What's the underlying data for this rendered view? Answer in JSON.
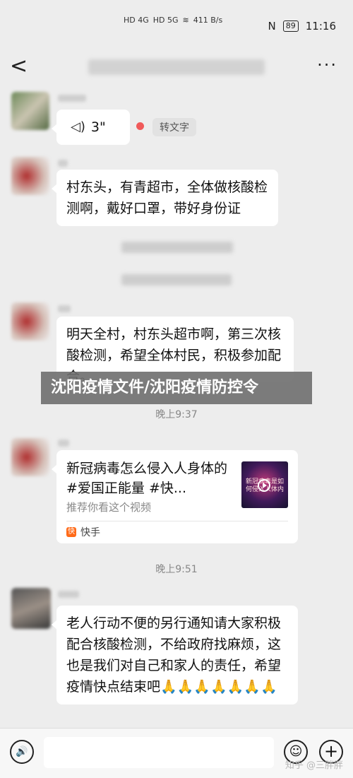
{
  "status_bar": {
    "net1": "HD 4G",
    "net2": "HD 5G",
    "speed": "411 B/s",
    "battery": "89",
    "time": "11:16"
  },
  "nav": {
    "back": "<",
    "more": "···"
  },
  "messages": {
    "voice": {
      "duration": "3\"",
      "to_text": "转文字"
    },
    "msg1": "村东头，有青超市，全体做核酸检测啊，戴好口罩，带好身份证",
    "msg2": "明天全村，村东头超市啊，第三次核酸检测，希望全体村民，积极参加配合。",
    "banner": "沈阳疫情文件/沈阳疫情防控令",
    "time1": "晚上9:37",
    "card": {
      "title": "新冠病毒怎么侵入人身体的 #爱国正能量 #快...",
      "subtitle": "推荐你看这个视频",
      "thumb_text": "新冠病毒是如何侵入人体内",
      "source_icon": "快",
      "source": "快手"
    },
    "time2": "晚上9:51",
    "msg3": "老人行动不便的另行通知请大家积极配合核酸检测，不给政府找麻烦，这也是我们对自己和家人的责任，希望疫情快点结束吧🙏🙏🙏🙏🙏🙏🙏"
  },
  "input_bar": {
    "voice_icon": "🔊",
    "emoji_icon": "☺",
    "plus_icon": "+"
  },
  "watermark": "知乎 @三胖胖",
  "colors": {
    "background": "#ededed",
    "bubble": "#ffffff",
    "accent_red": "#f05a5a",
    "kuaishou": "#ff6a18"
  }
}
